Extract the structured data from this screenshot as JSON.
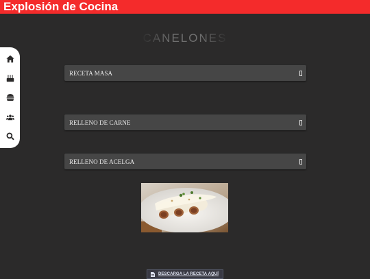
{
  "header": {
    "brand": "Explosión de Cocina"
  },
  "page": {
    "title": "CANELONES"
  },
  "sidenav": {
    "items": [
      {
        "icon": "home-icon"
      },
      {
        "icon": "cake-icon"
      },
      {
        "icon": "burger-icon"
      },
      {
        "icon": "users-icon"
      },
      {
        "icon": "search-icon"
      }
    ]
  },
  "accordions": [
    {
      "label": "RECETA MASA"
    },
    {
      "label": "RELLENO DE CARNE"
    },
    {
      "label": "RELLENO DE ACELGA"
    }
  ],
  "download": {
    "label": "DESCARGA LA RECETA AQUÍ",
    "icon": "document-icon"
  },
  "colors": {
    "header": "#f42b2b",
    "background": "#2b2a2a",
    "panel": "#464646"
  }
}
